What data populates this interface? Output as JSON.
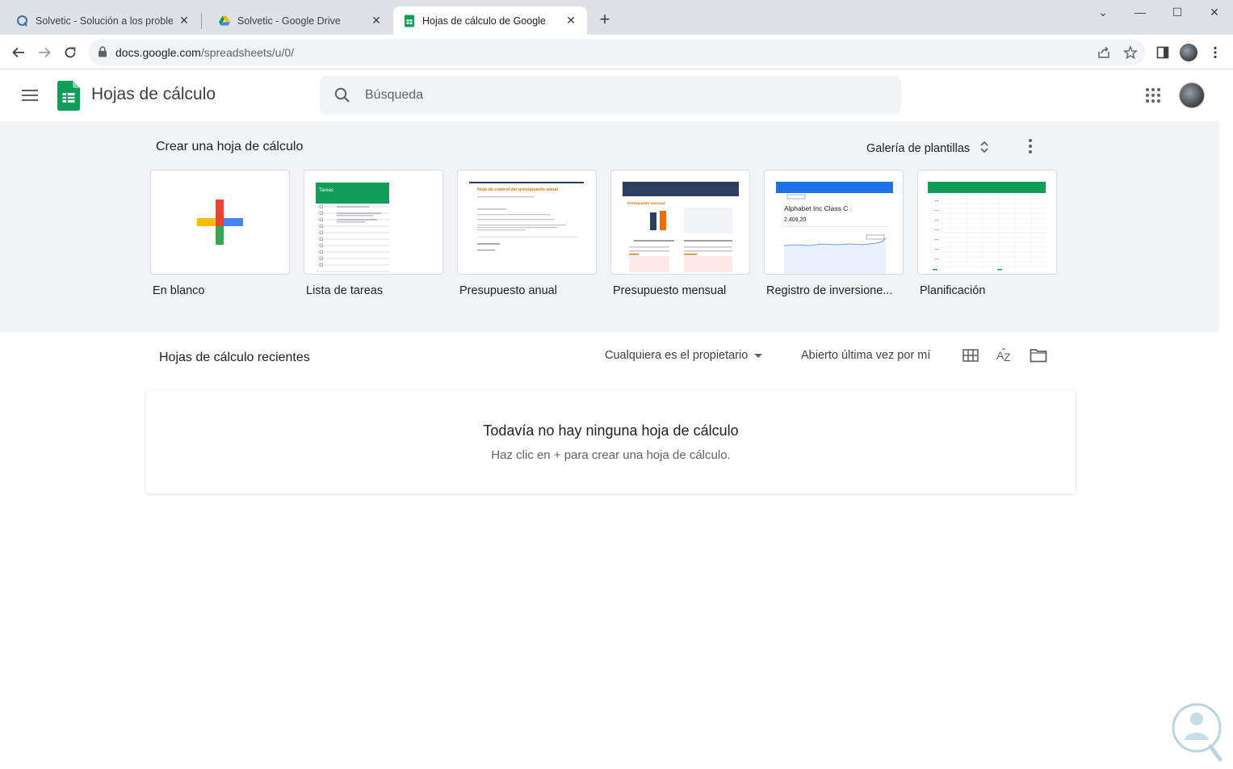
{
  "browser": {
    "tabs": [
      {
        "title": "Solvetic - Solución a los problem",
        "active": false,
        "favicon": "solvetic-icon"
      },
      {
        "title": "Solvetic - Google Drive",
        "active": false,
        "favicon": "drive-icon"
      },
      {
        "title": "Hojas de cálculo de Google",
        "active": true,
        "favicon": "sheets-icon"
      }
    ],
    "new_tab": "+",
    "url_host": "docs.google.com",
    "url_path": "/spreadsheets/u/0/",
    "window_controls": {
      "collapse": "⌄",
      "minimize": "—",
      "maximize": "☐",
      "close": "✕"
    }
  },
  "header": {
    "app_title": "Hojas de cálculo",
    "search_placeholder": "Búsqueda"
  },
  "gallery": {
    "title": "Crear una hoja de cálculo",
    "link_label": "Galería de plantillas",
    "templates": [
      {
        "label": "En blanco"
      },
      {
        "label": "Lista de tareas"
      },
      {
        "label": "Presupuesto anual"
      },
      {
        "label": "Presupuesto mensual"
      },
      {
        "label": "Registro de inversione..."
      },
      {
        "label": "Planificación"
      }
    ],
    "thumb_text": {
      "tareas": "Tareas",
      "annual": "Hoja de control del presupuesto anual",
      "monthly": "Presupuesto mensual",
      "invest": "Alphabet Inc Class C",
      "invest_value": "2.409,20"
    }
  },
  "recent": {
    "title": "Hojas de cálculo recientes",
    "owner_filter": "Cualquiera es el propietario",
    "sort_label": "Abierto última vez por mí",
    "empty_title": "Todavía no hay ninguna hoja de cálculo",
    "empty_subtitle": "Haz clic en + para crear una hoja de cálculo."
  },
  "colors": {
    "sheets_green": "#0f9d58",
    "gallery_bg": "#f1f3f4",
    "accent_orange": "#e8710a",
    "navy": "#2c3e5d",
    "blue": "#1a73e8"
  }
}
